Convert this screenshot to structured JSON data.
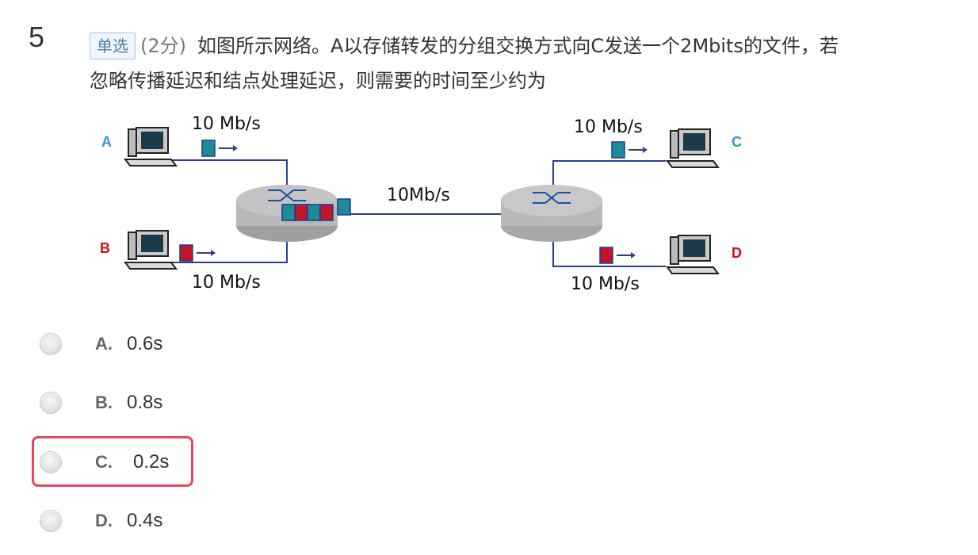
{
  "question": {
    "number": "5",
    "type_badge": "单选",
    "score": "(2分)",
    "stem_line1": "如图所示网络。A以存储转发的分组交换方式向C发送一个2Mbits的文件，若",
    "stem_line2": "忽略传播延迟和结点处理延迟，则需要的时间至少约为"
  },
  "diagram": {
    "host_a_label": "A",
    "host_b_label": "B",
    "host_c_label": "C",
    "host_d_label": "D",
    "link_a_rate": "10 Mb/s",
    "link_b_rate": "10 Mb/s",
    "link_core_rate": "10Mb/s",
    "link_c_rate": "10 Mb/s",
    "link_d_rate": "10 Mb/s",
    "colors": {
      "packet_a": "#1f8a9a",
      "packet_b": "#c0152a",
      "router": "#b8b8b8",
      "link": "#2a3f8f",
      "label_a_c": "#3399cc",
      "label_b_d": "#d0111f"
    }
  },
  "options": [
    {
      "letter": "A.",
      "text": "0.6s",
      "selected": false
    },
    {
      "letter": "B.",
      "text": "0.8s",
      "selected": false
    },
    {
      "letter": "C.",
      "text": "0.2s",
      "selected": false
    },
    {
      "letter": "D.",
      "text": "0.4s",
      "selected": false
    }
  ],
  "highlight_color": "#e8475d"
}
